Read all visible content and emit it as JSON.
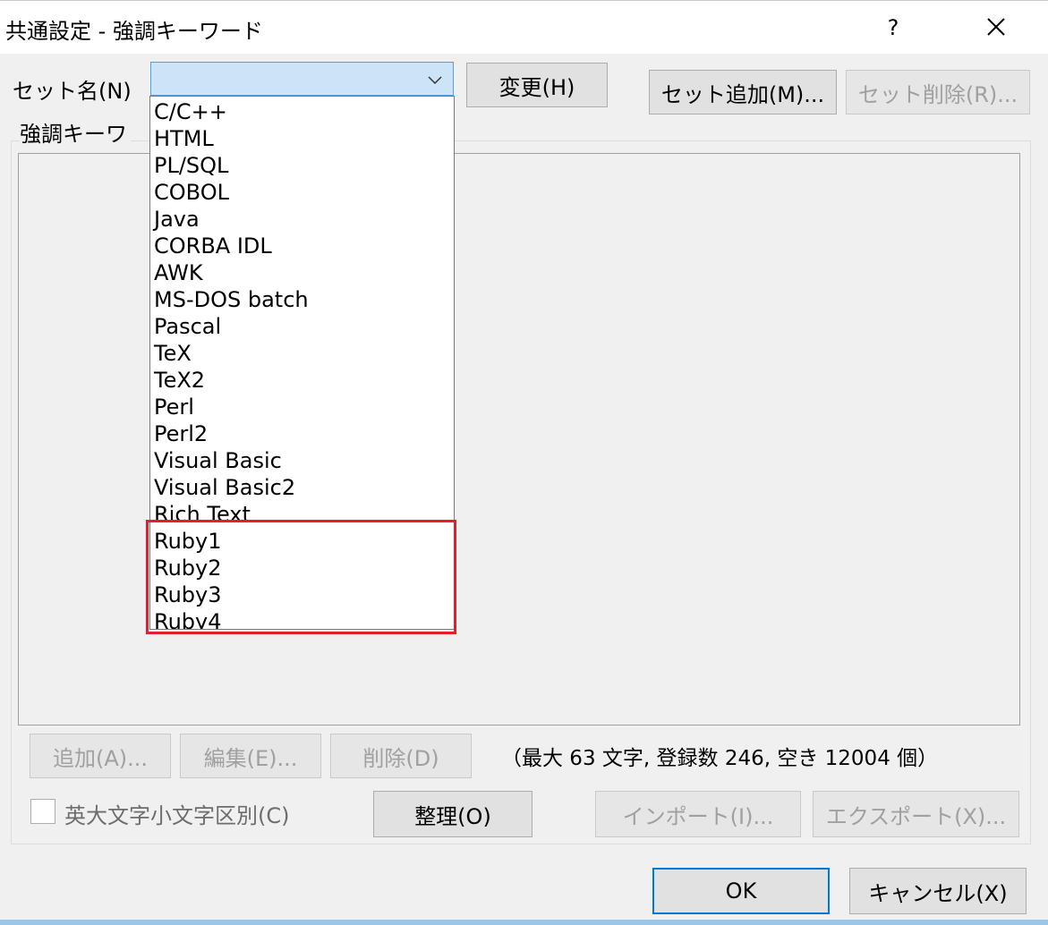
{
  "window": {
    "title": "共通設定 - 強調キーワード",
    "help_label": "?",
    "close_icon": "close-icon"
  },
  "setname": {
    "label": "セット名(N)",
    "selected_value": "",
    "change_button": "変更(H)",
    "add_set_button": "セット追加(M)...",
    "delete_set_button": "セット削除(R)..."
  },
  "dropdown": {
    "options": [
      "C/C++",
      "HTML",
      "PL/SQL",
      "COBOL",
      "Java",
      "CORBA IDL",
      "AWK",
      "MS-DOS batch",
      "Pascal",
      "TeX",
      "TeX2",
      "Perl",
      "Perl2",
      "Visual Basic",
      "Visual Basic2",
      "Rich Text",
      "Ruby1",
      "Ruby2",
      "Ruby3",
      "Ruby4"
    ],
    "highlight_color": "#e0202a"
  },
  "group": {
    "label": "強調キーワ"
  },
  "actions": {
    "add": "追加(A)...",
    "edit": "編集(E)...",
    "delete": "削除(D)",
    "status": "（最大 63 文字, 登録数 246, 空き 12004 個）",
    "case_checkbox_label": "英大文字小文字区別(C)",
    "organize": "整理(O)",
    "import": "インポート(I)...",
    "export": "エクスポート(X)..."
  },
  "footer": {
    "ok": "OK",
    "cancel": "キャンセル(X)"
  },
  "colors": {
    "accent": "#0078d7",
    "combo_bg": "#cce4f7"
  }
}
